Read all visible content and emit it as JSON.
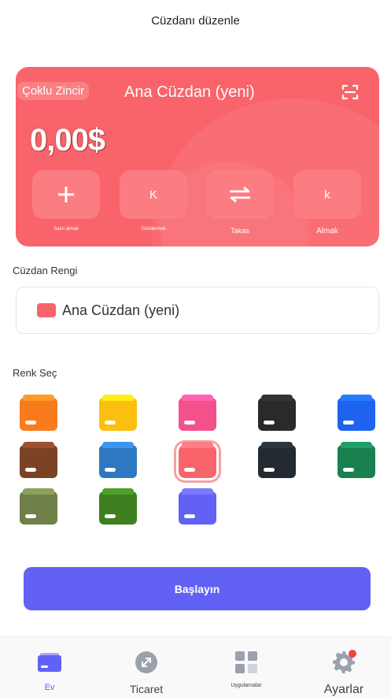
{
  "header": {
    "title": "Cüzdanı düzenle"
  },
  "card": {
    "chain_label": "Çoklu Zincir",
    "wallet_name": "Ana Cüzdan (yeni)",
    "balance": "0,00$",
    "color": "#f9646a",
    "actions": [
      {
        "label": "Satın almak",
        "icon": "plus-icon"
      },
      {
        "label": "Göndermek",
        "icon": "send-icon",
        "glyph": "K"
      },
      {
        "label": "Takas",
        "icon": "swap-icon"
      },
      {
        "label": "Almak",
        "icon": "receive-icon",
        "glyph": "k"
      }
    ]
  },
  "wallet_color_section": {
    "label": "Cüzdan Rengi",
    "field_value": "Ana Cüzdan (yeni)"
  },
  "color_picker": {
    "label": "Renk Seç",
    "colors": [
      "#f97c1c",
      "#fbbf0f",
      "#f4508c",
      "#2a2a2a",
      "#1e63f0",
      "#7b4226",
      "#2e78c1",
      "#f9646a",
      "#232a32",
      "#1a8050",
      "#6f8048",
      "#3e8020",
      "#6161f5"
    ],
    "selected_index": 7
  },
  "start_button": {
    "label": "Başlayın",
    "color": "#6261f5"
  },
  "bottom_nav": [
    {
      "label": "Ev",
      "icon": "wallet-icon",
      "active": true
    },
    {
      "label": "Ticaret",
      "icon": "trade-icon",
      "active": false
    },
    {
      "label": "Uygulamalar",
      "icon": "apps-icon",
      "active": false
    },
    {
      "label": "Ayarlar",
      "icon": "gear-icon",
      "active": false,
      "badge": true
    }
  ]
}
